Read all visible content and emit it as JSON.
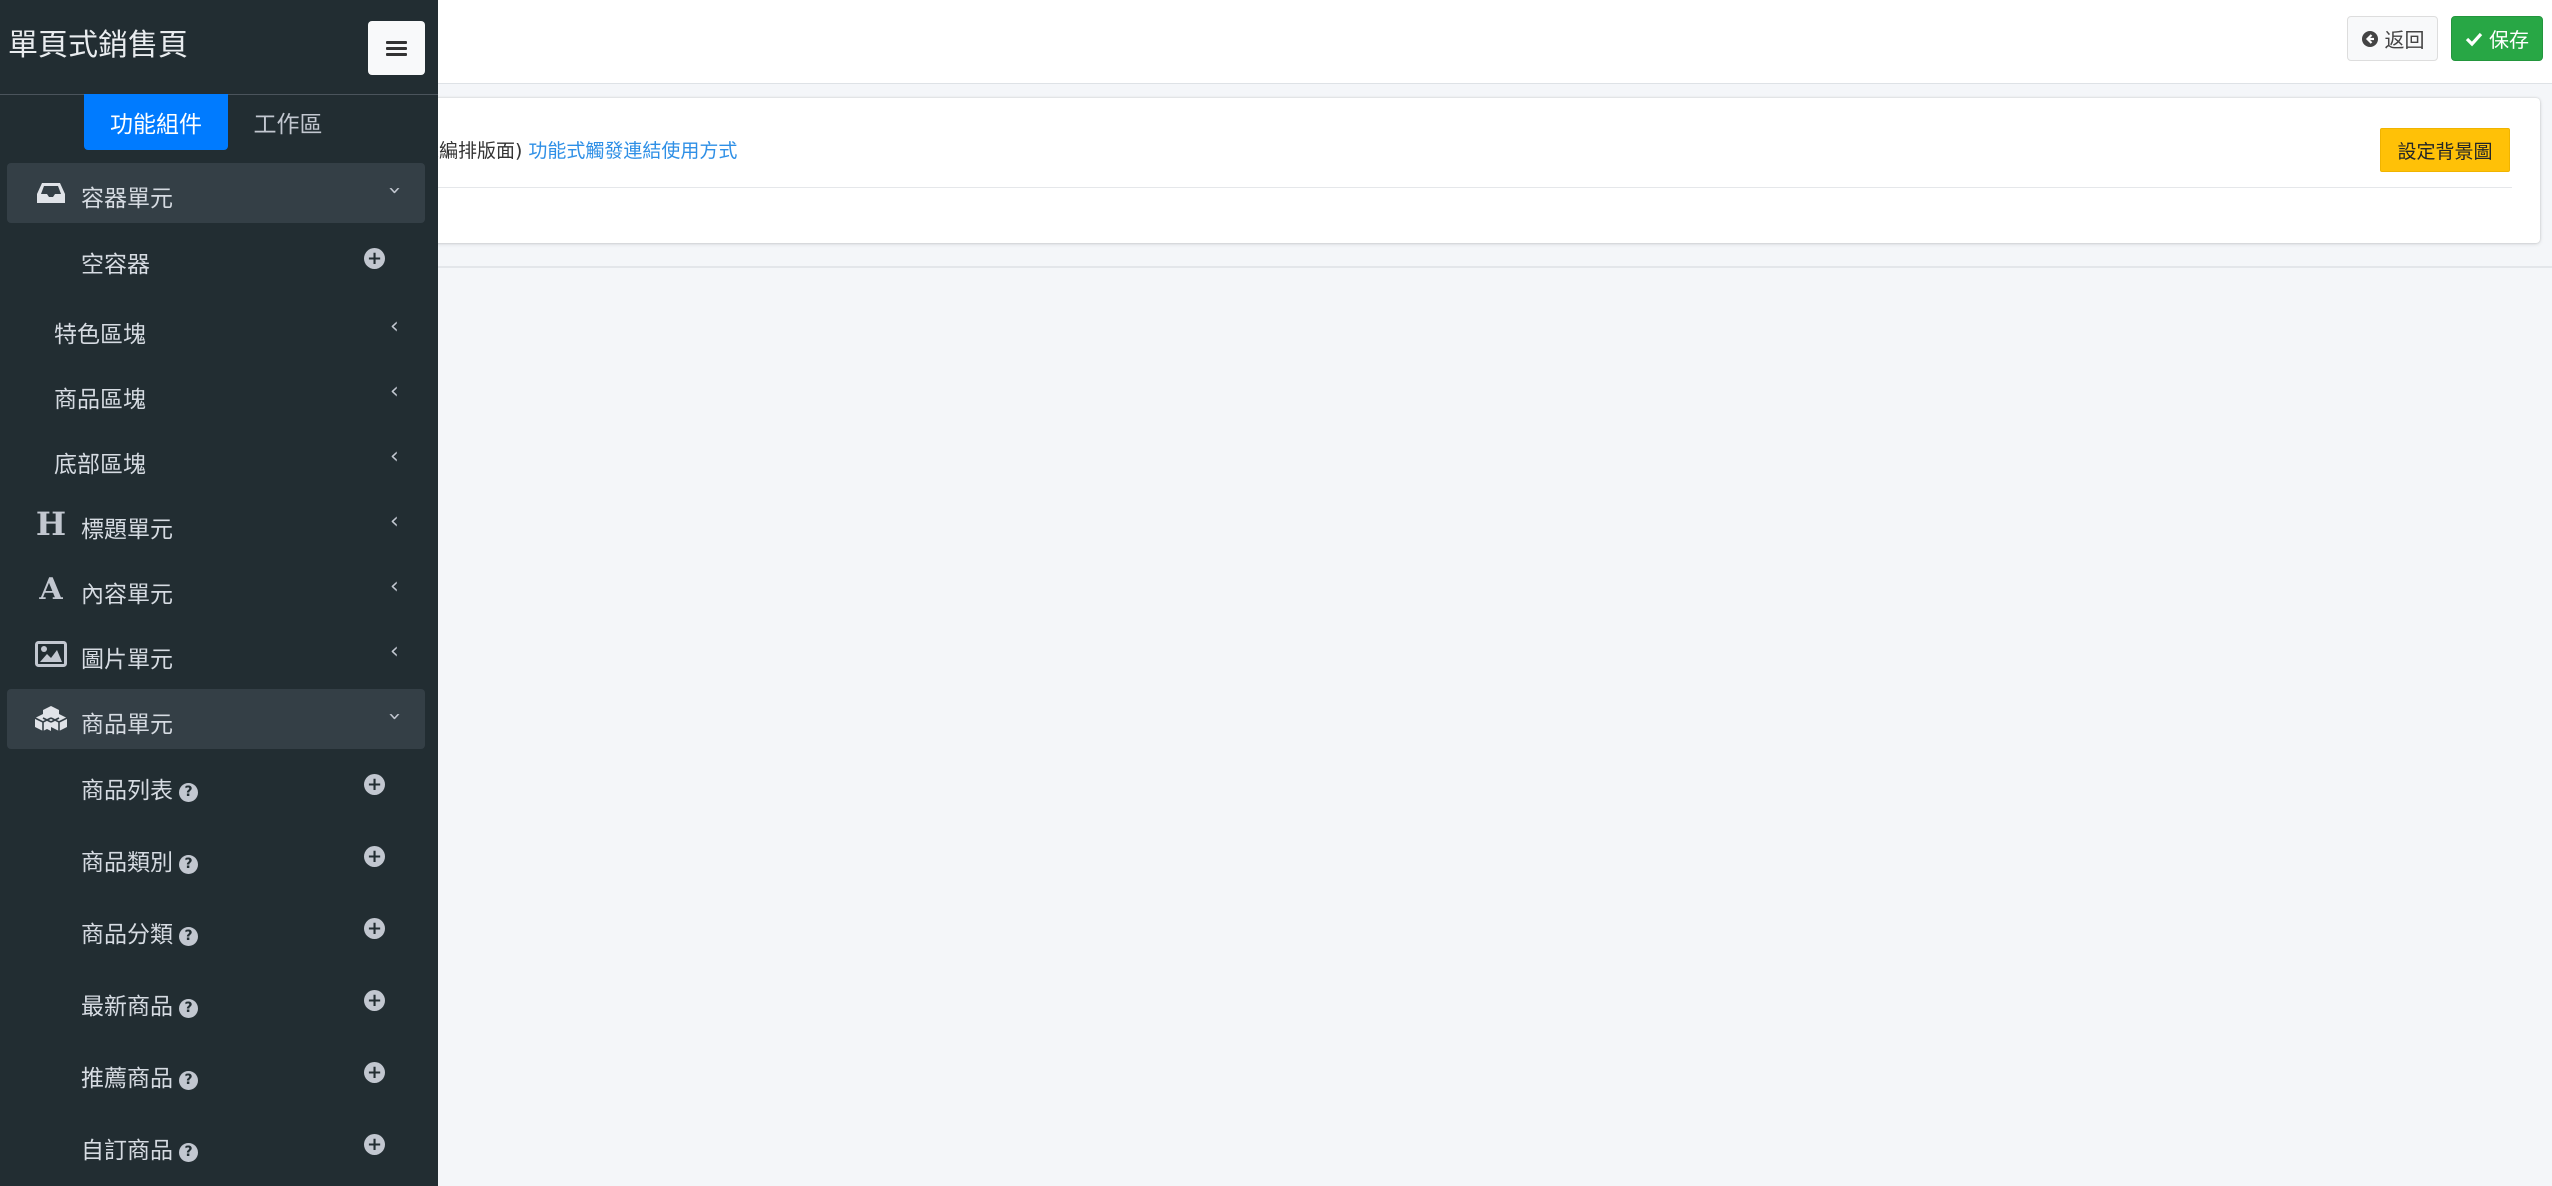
{
  "header": {
    "back_label": "返回",
    "save_label": "保存"
  },
  "card": {
    "text": "境編排版面)",
    "link": "功能式觸發連結使用方式",
    "bg_button": "設定背景圖"
  },
  "sidebar": {
    "title": "單頁式銷售頁",
    "tabs": [
      "功能組件",
      "工作區"
    ],
    "items": [
      {
        "label": "容器單元",
        "icon": "inbox-icon",
        "state": "expanded"
      },
      {
        "label": "空容器",
        "icon": "plus-circle-icon"
      },
      {
        "label": "特色區塊",
        "state": "collapsed"
      },
      {
        "label": "商品區塊",
        "state": "collapsed"
      },
      {
        "label": "底部區塊",
        "state": "collapsed"
      },
      {
        "label": "標題單元",
        "icon": "heading-icon",
        "state": "collapsed"
      },
      {
        "label": "內容單元",
        "icon": "font-icon",
        "state": "collapsed"
      },
      {
        "label": "圖片單元",
        "icon": "image-icon",
        "state": "collapsed"
      },
      {
        "label": "商品單元",
        "icon": "cubes-icon",
        "state": "expanded"
      },
      {
        "label": "商品列表",
        "icon": "plus-circle-icon",
        "help": true
      },
      {
        "label": "商品類別",
        "icon": "plus-circle-icon",
        "help": true
      },
      {
        "label": "商品分類",
        "icon": "plus-circle-icon",
        "help": true
      },
      {
        "label": "最新商品",
        "icon": "plus-circle-icon",
        "help": true
      },
      {
        "label": "推薦商品",
        "icon": "plus-circle-icon",
        "help": true
      },
      {
        "label": "自訂商品",
        "icon": "plus-circle-icon",
        "help": true
      }
    ]
  },
  "colors": {
    "sidebar_bg": "#222d32",
    "active_tab": "#007bff",
    "save": "#28a745",
    "warning": "#ffc107",
    "link": "#2e8fe6"
  }
}
